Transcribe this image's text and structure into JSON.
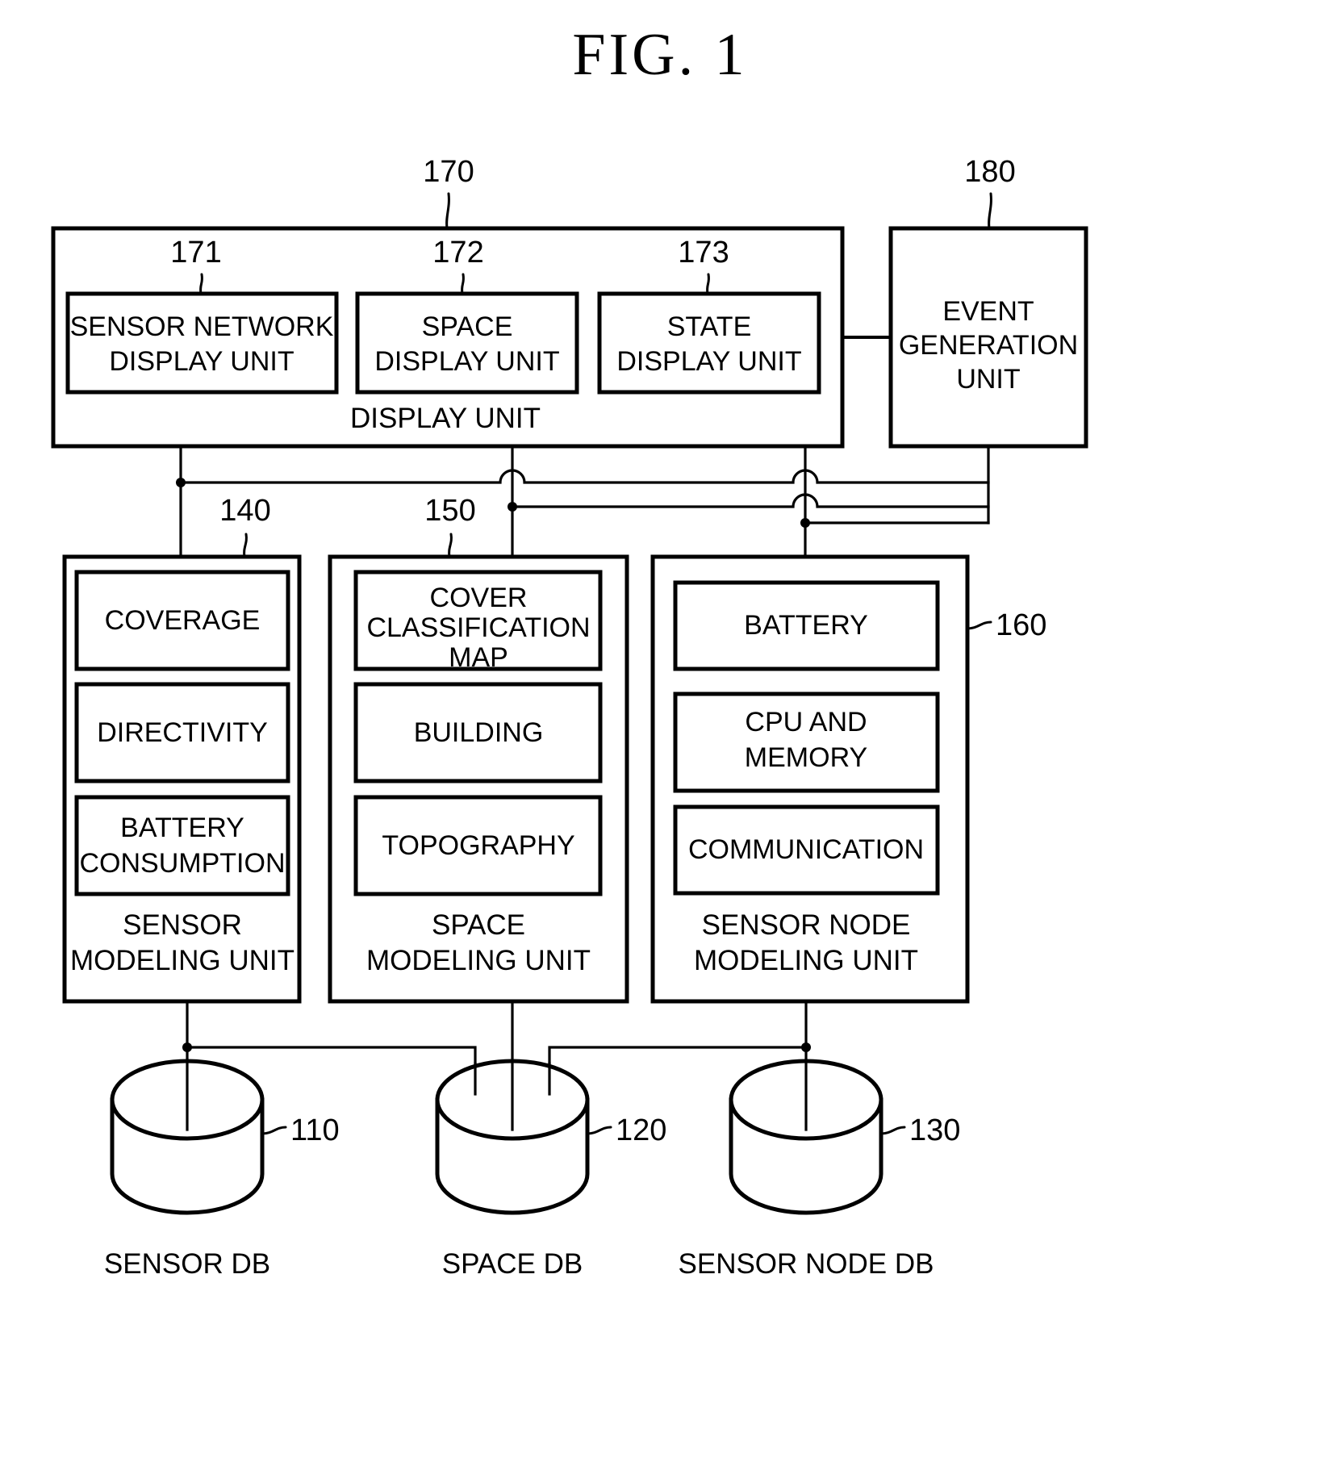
{
  "figure": {
    "title": "FIG.  1"
  },
  "display_section": {
    "ref": "170",
    "label": "DISPLAY UNIT",
    "children": [
      {
        "ref": "171",
        "line1": "SENSOR NETWORK",
        "line2": "DISPLAY UNIT"
      },
      {
        "ref": "172",
        "line1": "SPACE",
        "line2": "DISPLAY UNIT"
      },
      {
        "ref": "173",
        "line1": "STATE",
        "line2": "DISPLAY UNIT"
      }
    ]
  },
  "event_unit": {
    "ref": "180",
    "line1": "EVENT",
    "line2": "GENERATION",
    "line3": "UNIT"
  },
  "modeling_units": [
    {
      "ref": "140",
      "ref_position": "top",
      "label_line1": "SENSOR",
      "label_line2": "MODELING UNIT",
      "items": [
        {
          "lines": [
            "COVERAGE"
          ]
        },
        {
          "lines": [
            "DIRECTIVITY"
          ]
        },
        {
          "lines": [
            "BATTERY",
            "CONSUMPTION"
          ]
        }
      ]
    },
    {
      "ref": "150",
      "ref_position": "top",
      "label_line1": "SPACE",
      "label_line2": "MODELING UNIT",
      "items": [
        {
          "lines": [
            "COVER",
            "CLASSIFICATION",
            "MAP"
          ]
        },
        {
          "lines": [
            "BUILDING"
          ]
        },
        {
          "lines": [
            "TOPOGRAPHY"
          ]
        }
      ]
    },
    {
      "ref": "160",
      "ref_position": "right",
      "label_line1": "SENSOR NODE",
      "label_line2": "MODELING UNIT",
      "items": [
        {
          "lines": [
            "BATTERY"
          ]
        },
        {
          "lines": [
            "CPU AND",
            "MEMORY"
          ]
        },
        {
          "lines": [
            "COMMUNICATION"
          ]
        }
      ]
    }
  ],
  "databases": [
    {
      "ref": "110",
      "label": "SENSOR DB"
    },
    {
      "ref": "120",
      "label": "SPACE DB"
    },
    {
      "ref": "130",
      "label": "SENSOR NODE DB"
    }
  ],
  "colors": {
    "ink": "#000000",
    "paper": "#ffffff"
  }
}
